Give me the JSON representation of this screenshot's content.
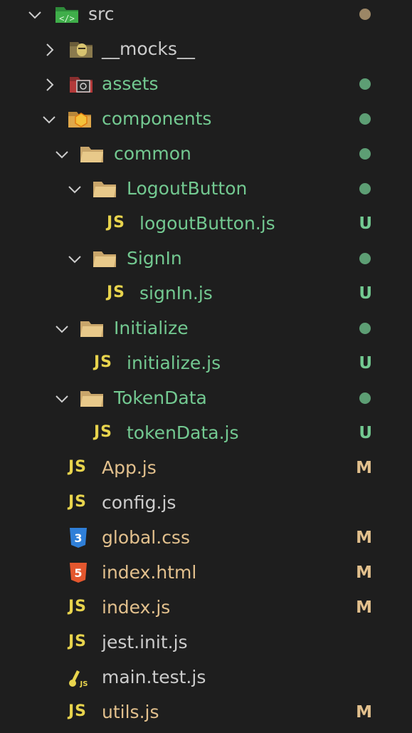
{
  "explorer": {
    "items": [
      {
        "label": "src",
        "status": "",
        "dot": "yellow"
      },
      {
        "label": "__mocks__",
        "status": "",
        "dot": ""
      },
      {
        "label": "assets",
        "status": "",
        "dot": "green"
      },
      {
        "label": "components",
        "status": "",
        "dot": "green"
      },
      {
        "label": "common",
        "status": "",
        "dot": "green"
      },
      {
        "label": "LogoutButton",
        "status": "",
        "dot": "green"
      },
      {
        "label": "logoutButton.js",
        "status": "U",
        "dot": ""
      },
      {
        "label": "SignIn",
        "status": "",
        "dot": "green"
      },
      {
        "label": "signIn.js",
        "status": "U",
        "dot": ""
      },
      {
        "label": "Initialize",
        "status": "",
        "dot": "green"
      },
      {
        "label": "initialize.js",
        "status": "U",
        "dot": ""
      },
      {
        "label": "TokenData",
        "status": "",
        "dot": "green"
      },
      {
        "label": "tokenData.js",
        "status": "U",
        "dot": ""
      },
      {
        "label": "App.js",
        "status": "M",
        "dot": ""
      },
      {
        "label": "config.js",
        "status": "",
        "dot": ""
      },
      {
        "label": "global.css",
        "status": "M",
        "dot": ""
      },
      {
        "label": "index.html",
        "status": "M",
        "dot": ""
      },
      {
        "label": "index.js",
        "status": "M",
        "dot": ""
      },
      {
        "label": "jest.init.js",
        "status": "",
        "dot": ""
      },
      {
        "label": "main.test.js",
        "status": "",
        "dot": ""
      },
      {
        "label": "utils.js",
        "status": "M",
        "dot": ""
      }
    ],
    "js_badge": "JS",
    "colors": {
      "background": "#1e1e1e",
      "untracked": "#73c991",
      "modified": "#e2c08d",
      "default": "#cccccc",
      "js": "#e8d44d"
    }
  }
}
